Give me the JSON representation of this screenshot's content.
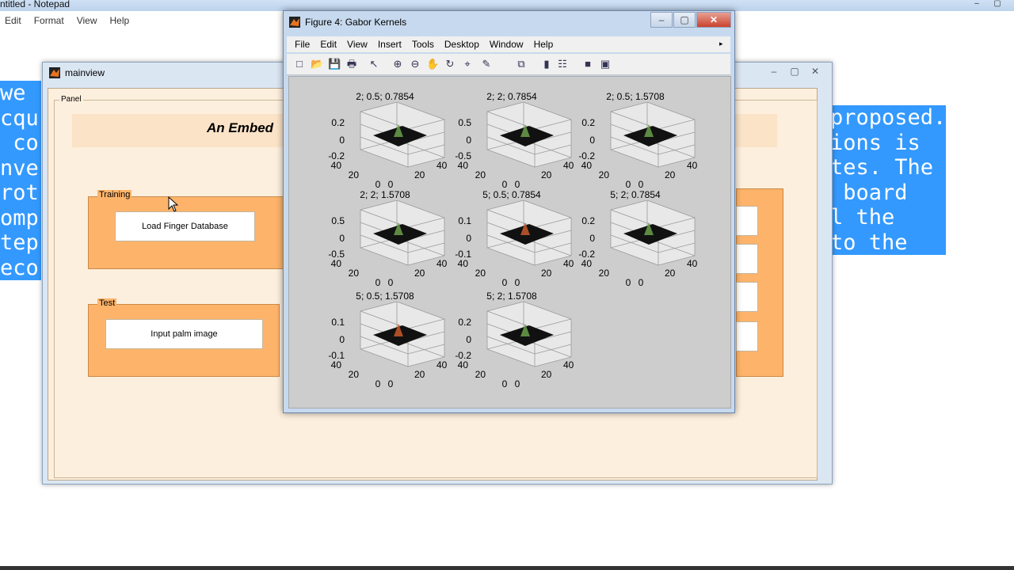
{
  "notepad": {
    "title": "ntitled - Notepad",
    "controls": [
      "–",
      "▢",
      "✕"
    ],
    "menu": [
      "Edit",
      "Format",
      "View",
      "Help"
    ],
    "left_text": [
      "we",
      "cqu",
      " co",
      "nve",
      "rot",
      "omp",
      "tep",
      "eco"
    ],
    "right_text": [
      "proposed.",
      "ions is",
      "tes. The",
      " board",
      "l the",
      "to the"
    ]
  },
  "mainview": {
    "title": "mainview",
    "controls": [
      "–",
      "▢",
      "✕"
    ],
    "panel_label": "Panel",
    "app_title": "An Embed",
    "training_label": "Training",
    "load_button": "Load Finger Database",
    "test_label": "Test",
    "input_button": "Input palm image"
  },
  "figure": {
    "title": "Figure 4: Gabor Kernels",
    "controls": [
      "–",
      "▢",
      "✕"
    ],
    "menu": [
      "File",
      "Edit",
      "View",
      "Insert",
      "Tools",
      "Desktop",
      "Window",
      "Help"
    ],
    "menu_arrow": "▸",
    "toolbar_icons": [
      {
        "name": "new-figure-icon",
        "glyph": "□"
      },
      {
        "name": "open-file-icon",
        "glyph": "📂"
      },
      {
        "name": "save-icon",
        "glyph": "💾"
      },
      {
        "name": "print-icon",
        "glyph": "🖶"
      },
      {
        "name": "pointer-icon",
        "glyph": "↖"
      },
      {
        "name": "zoom-in-icon",
        "glyph": "⊕"
      },
      {
        "name": "zoom-out-icon",
        "glyph": "⊖"
      },
      {
        "name": "pan-icon",
        "glyph": "✋"
      },
      {
        "name": "rotate-icon",
        "glyph": "↻"
      },
      {
        "name": "data-cursor-icon",
        "glyph": "⌖"
      },
      {
        "name": "brush-icon",
        "glyph": "✎"
      },
      {
        "name": "link-icon",
        "glyph": "⧉"
      },
      {
        "name": "colorbar-icon",
        "glyph": "▮"
      },
      {
        "name": "legend-icon",
        "glyph": "☷"
      },
      {
        "name": "hide-tools-icon",
        "glyph": "■"
      },
      {
        "name": "dock-icon",
        "glyph": "▣"
      }
    ],
    "plots": [
      {
        "title": "2; 0.5; 0.7854",
        "zticks": [
          "0.2",
          "0",
          "-0.2"
        ]
      },
      {
        "title": "2; 2; 0.7854",
        "zticks": [
          "0.5",
          "0",
          "-0.5"
        ]
      },
      {
        "title": "2; 0.5; 1.5708",
        "zticks": [
          "0.2",
          "0",
          "-0.2"
        ]
      },
      {
        "title": "2; 2; 1.5708",
        "zticks": [
          "0.5",
          "0",
          "-0.5"
        ]
      },
      {
        "title": "5; 0.5; 0.7854",
        "zticks": [
          "0.1",
          "0",
          "-0.1"
        ]
      },
      {
        "title": "5; 2; 0.7854",
        "zticks": [
          "0.2",
          "0",
          "-0.2"
        ]
      },
      {
        "title": "5; 0.5; 1.5708",
        "zticks": [
          "0.1",
          "0",
          "-0.1"
        ]
      },
      {
        "title": "5; 2; 1.5708",
        "zticks": [
          "0.2",
          "0",
          "-0.2"
        ]
      }
    ],
    "axis_ticks": {
      "y_left": "40",
      "y_mid": "20",
      "x_zero_a": "0",
      "x_zero_b": "0",
      "x_mid": "20",
      "x_right": "40"
    }
  }
}
